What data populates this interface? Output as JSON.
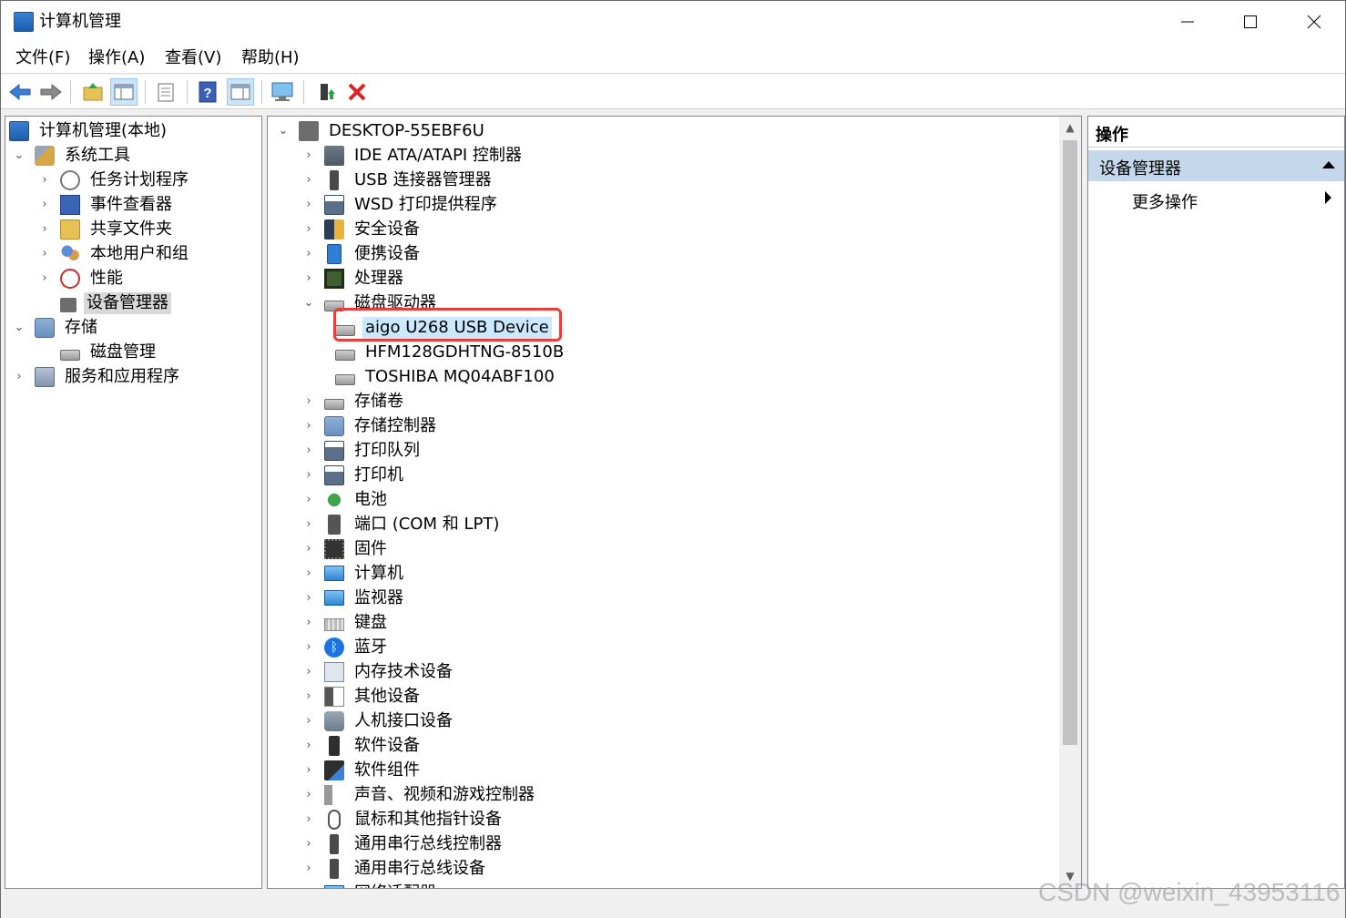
{
  "window": {
    "title": "计算机管理",
    "controls": {
      "minimize": "minimize",
      "maximize": "maximize",
      "close": "close"
    }
  },
  "menu": [
    "文件(F)",
    "操作(A)",
    "查看(V)",
    "帮助(H)"
  ],
  "toolbar": {
    "buttons": [
      "back-icon",
      "forward-icon",
      "up-folder-icon",
      "show-console-tree-icon",
      "properties-icon",
      "help-icon",
      "show-action-pane-icon",
      "monitor-icon",
      "update-driver-icon",
      "uninstall-icon"
    ]
  },
  "left_tree": {
    "root": "计算机管理(本地)",
    "system_tools": "系统工具",
    "task_scheduler": "任务计划程序",
    "event_viewer": "事件查看器",
    "shared_folders": "共享文件夹",
    "local_users": "本地用户和组",
    "performance": "性能",
    "device_manager": "设备管理器",
    "storage": "存储",
    "disk_management": "磁盘管理",
    "services_apps": "服务和应用程序"
  },
  "device_tree": {
    "computer": "DESKTOP-55EBF6U",
    "categories": [
      "IDE ATA/ATAPI 控制器",
      "USB 连接器管理器",
      "WSD 打印提供程序",
      "安全设备",
      "便携设备",
      "处理器",
      "磁盘驱动器"
    ],
    "disks": [
      "aigo U268 USB Device",
      "HFM128GDHTNG-8510B",
      "TOSHIBA MQ04ABF100"
    ],
    "categories_after": [
      "存储卷",
      "存储控制器",
      "打印队列",
      "打印机",
      "电池",
      "端口 (COM 和 LPT)",
      "固件",
      "计算机",
      "监视器",
      "键盘",
      "蓝牙",
      "内存技术设备",
      "其他设备",
      "人机接口设备",
      "软件设备",
      "软件组件",
      "声音、视频和游戏控制器",
      "鼠标和其他指针设备",
      "通用串行总线控制器",
      "通用串行总线设备",
      "网络适配器"
    ]
  },
  "actions_pane": {
    "header": "操作",
    "group": "设备管理器",
    "more": "更多操作"
  },
  "watermark": "CSDN @weixin_43953116",
  "colors": {
    "highlight_border": "#e5403a",
    "selection_blue": "#cce8ff",
    "actions_group_bg": "#c5d7ea"
  }
}
